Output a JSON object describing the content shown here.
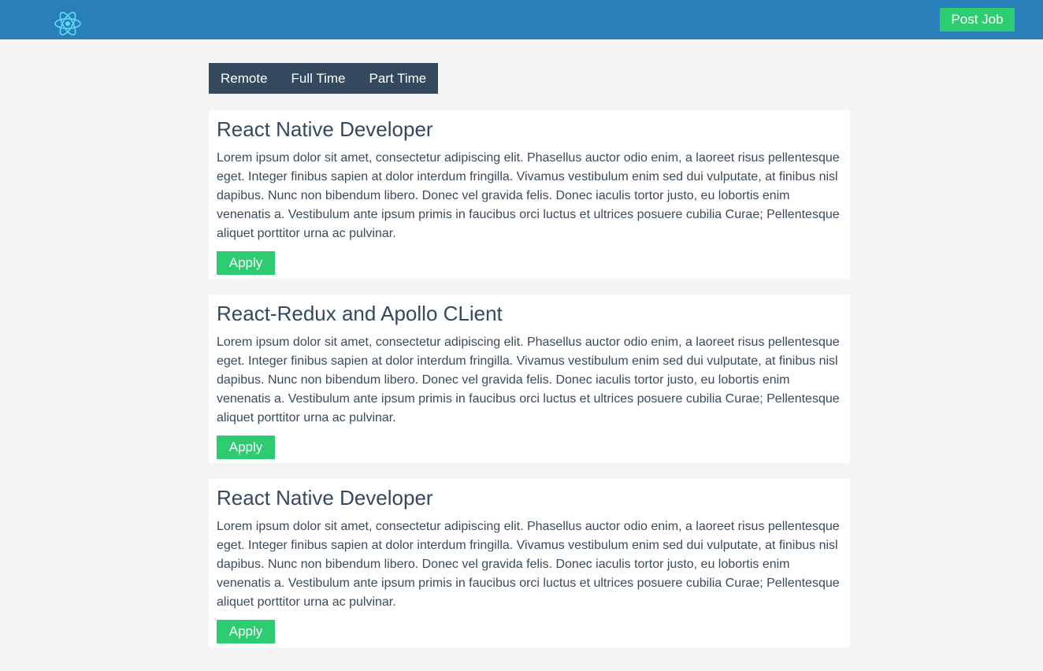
{
  "header": {
    "logo_icon": "react-atom-icon",
    "post_job_label": "Post Job"
  },
  "filters": [
    {
      "label": "Remote"
    },
    {
      "label": "Full Time"
    },
    {
      "label": "Part Time"
    }
  ],
  "jobs": [
    {
      "title": "React Native Developer",
      "description": "Lorem ipsum dolor sit amet, consectetur adipiscing elit. Phasellus auctor odio enim, a laoreet risus pellentesque eget. Integer finibus sapien at dolor interdum fringilla. Vivamus vestibulum enim sed dui vulputate, at finibus nisl dapibus. Nunc non bibendum libero. Donec vel gravida felis. Donec iaculis tortor justo, eu lobortis enim venenatis a. Vestibulum ante ipsum primis in faucibus orci luctus et ultrices posuere cubilia Curae; Pellentesque aliquet porttitor urna ac pulvinar.",
      "apply_label": "Apply"
    },
    {
      "title": "React-Redux and Apollo CLient",
      "description": "Lorem ipsum dolor sit amet, consectetur adipiscing elit. Phasellus auctor odio enim, a laoreet risus pellentesque eget. Integer finibus sapien at dolor interdum fringilla. Vivamus vestibulum enim sed dui vulputate, at finibus nisl dapibus. Nunc non bibendum libero. Donec vel gravida felis. Donec iaculis tortor justo, eu lobortis enim venenatis a. Vestibulum ante ipsum primis in faucibus orci luctus et ultrices posuere cubilia Curae; Pellentesque aliquet porttitor urna ac pulvinar.",
      "apply_label": "Apply"
    },
    {
      "title": "React Native Developer",
      "description": "Lorem ipsum dolor sit amet, consectetur adipiscing elit. Phasellus auctor odio enim, a laoreet risus pellentesque eget. Integer finibus sapien at dolor interdum fringilla. Vivamus vestibulum enim sed dui vulputate, at finibus nisl dapibus. Nunc non bibendum libero. Donec vel gravida felis. Donec iaculis tortor justo, eu lobortis enim venenatis a. Vestibulum ante ipsum primis in faucibus orci luctus et ultrices posuere cubilia Curae; Pellentesque aliquet porttitor urna ac pulvinar.",
      "apply_label": "Apply"
    }
  ],
  "colors": {
    "header_bg": "#2980b9",
    "accent_green": "#2ecc71",
    "filter_bar_bg": "#34495e",
    "title_text": "#34495e",
    "page_bg": "#f5f5f5",
    "logo_color": "#61dafb"
  }
}
